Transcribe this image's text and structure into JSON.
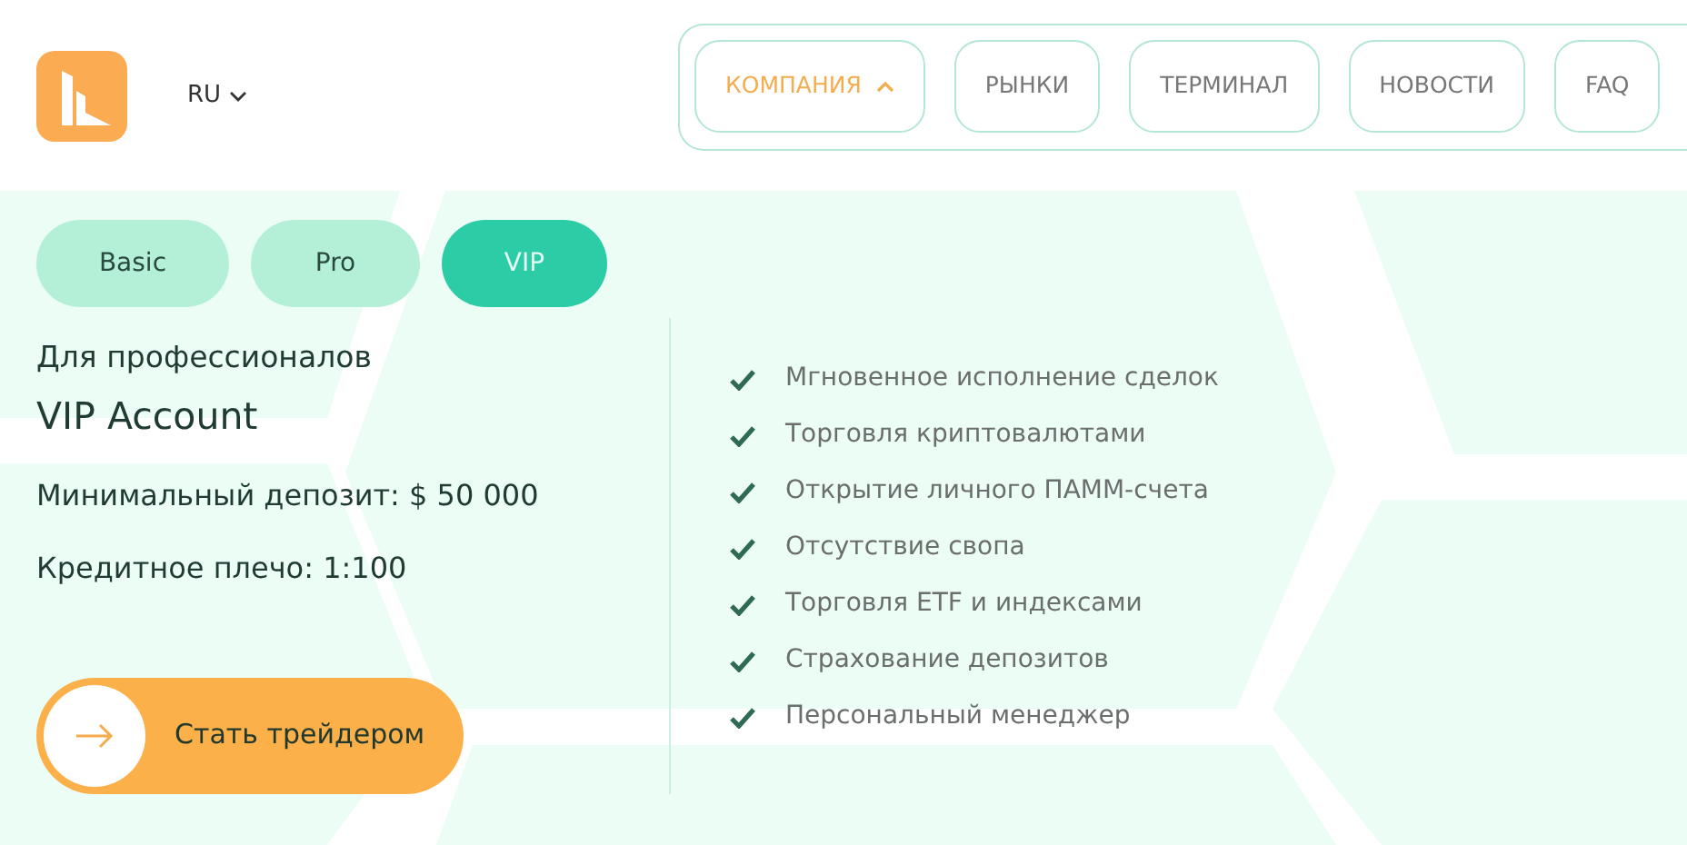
{
  "header": {
    "language": "RU",
    "nav": [
      {
        "label": "КОМПАНИЯ",
        "selected": true,
        "expanded": true
      },
      {
        "label": "РЫНКИ",
        "selected": false,
        "expanded": false
      },
      {
        "label": "ТЕРМИНАЛ",
        "selected": false,
        "expanded": false
      },
      {
        "label": "НОВОСТИ",
        "selected": false,
        "expanded": false
      },
      {
        "label": "FAQ",
        "selected": false,
        "expanded": false
      }
    ]
  },
  "plan_tabs": [
    {
      "label": "Basic",
      "selected": false
    },
    {
      "label": "Pro",
      "selected": false
    },
    {
      "label": "VIP",
      "selected": true
    }
  ],
  "plan": {
    "subtitle": "Для профессионалов",
    "title": "VIP Account",
    "deposit": "Минимальный депозит: $ 50 000",
    "leverage": "Кредитное плечо: 1:100",
    "cta": "Стать трейдером"
  },
  "features": [
    "Мгновенное исполнение сделок",
    "Торговля криптовалютами",
    "Открытие личного ПАММ-счета",
    "Отсутствие свопа",
    "Торговля ETF и индексами",
    "Страхование депозитов",
    "Персональный менеджер"
  ]
}
